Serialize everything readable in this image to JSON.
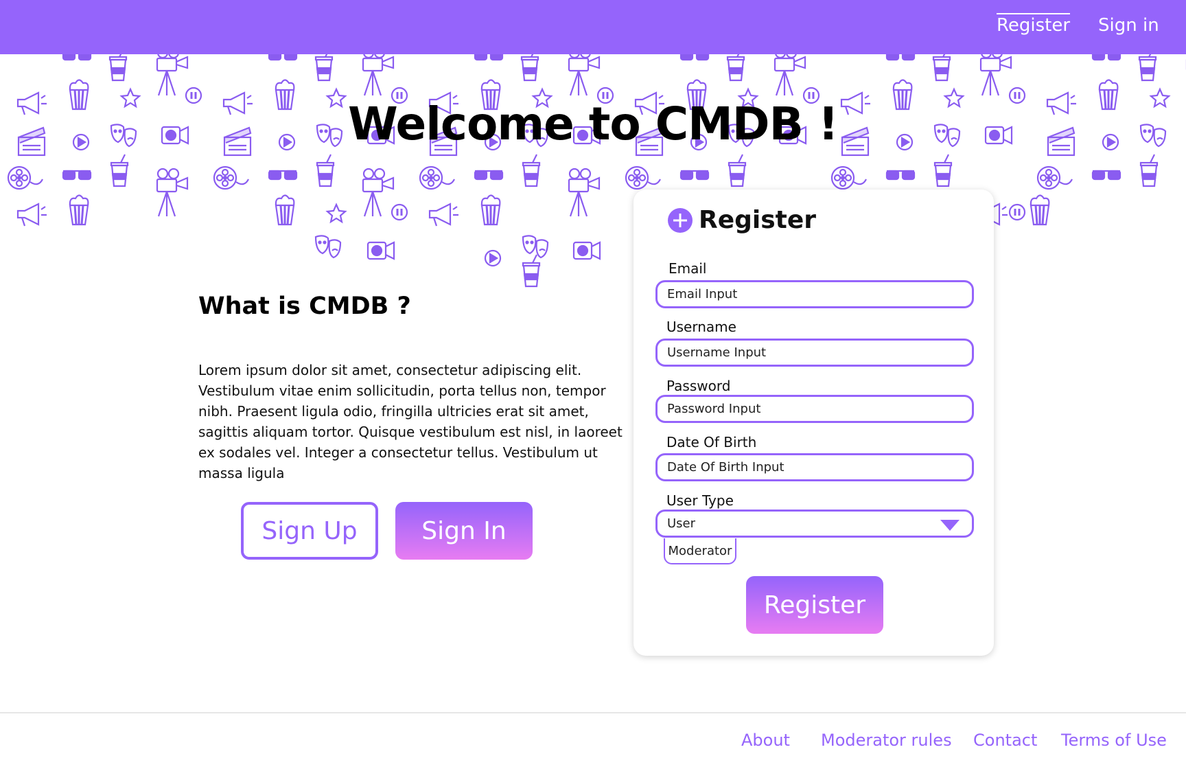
{
  "colors": {
    "primary": "#9564fb",
    "gradient_end": "#e77cf2",
    "text": "#111111",
    "background": "#ffffff"
  },
  "header": {
    "nav": {
      "register": "Register",
      "sign_in": "Sign in"
    }
  },
  "hero": {
    "title": "Welcome to CMDB !"
  },
  "about": {
    "title": "What is CMDB ?",
    "body": "Lorem ipsum dolor sit amet, consectetur adipiscing elit. Vestibulum vitae enim sollicitudin, porta tellus non, tempor nibh. Praesent ligula odio, fringilla ultricies erat sit amet, sagittis aliquam tortor. Quisque vestibulum est nisl, in laoreet ex sodales vel. Integer a consectetur tellus. Vestibulum ut massa ligula",
    "sign_up_label": "Sign Up",
    "sign_in_label": "Sign In"
  },
  "register_form": {
    "title": "Register",
    "icon": "plus-circle-icon",
    "fields": {
      "email": {
        "label": "Email",
        "value": "Email Input"
      },
      "username": {
        "label": "Username",
        "value": "Username Input"
      },
      "password": {
        "label": "Password",
        "value": "Password Input"
      },
      "dob": {
        "label": "Date Of Birth",
        "value": "Date Of Birth Input"
      },
      "user_type": {
        "label": "User Type",
        "selected": "User",
        "options": [
          "Moderator"
        ]
      }
    },
    "submit_label": "Register"
  },
  "footer": {
    "links": {
      "about": "About",
      "moderator_rules": "Moderator rules",
      "contact": "Contact",
      "terms": "Terms of Use"
    }
  }
}
